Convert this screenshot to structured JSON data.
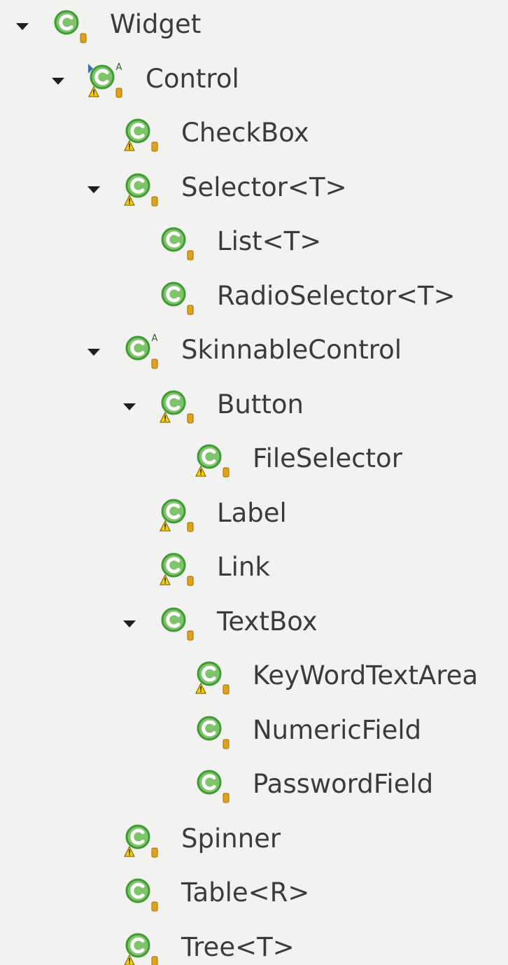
{
  "tree": {
    "nodes": [
      {
        "label": "Widget",
        "depth": 0,
        "expanded": true,
        "warning": false,
        "abstract": false,
        "tags": []
      },
      {
        "label": "Control",
        "depth": 1,
        "expanded": true,
        "warning": true,
        "abstract": true,
        "tags": [
          "abstract",
          "warning",
          "override"
        ]
      },
      {
        "label": "CheckBox",
        "depth": 2,
        "expanded": false,
        "warning": true,
        "abstract": false,
        "tags": [
          "warning"
        ]
      },
      {
        "label": "Selector<T>",
        "depth": 2,
        "expanded": true,
        "warning": true,
        "abstract": false,
        "tags": [
          "warning"
        ]
      },
      {
        "label": "List<T>",
        "depth": 3,
        "expanded": false,
        "warning": false,
        "abstract": false,
        "tags": []
      },
      {
        "label": "RadioSelector<T>",
        "depth": 3,
        "expanded": false,
        "warning": false,
        "abstract": false,
        "tags": []
      },
      {
        "label": "SkinnableControl",
        "depth": 2,
        "expanded": true,
        "warning": false,
        "abstract": true,
        "tags": [
          "abstract"
        ]
      },
      {
        "label": "Button",
        "depth": 3,
        "expanded": true,
        "warning": true,
        "abstract": false,
        "tags": [
          "warning"
        ]
      },
      {
        "label": "FileSelector",
        "depth": 4,
        "expanded": false,
        "warning": true,
        "abstract": false,
        "tags": [
          "warning"
        ]
      },
      {
        "label": "Label",
        "depth": 3,
        "expanded": false,
        "warning": true,
        "abstract": false,
        "tags": [
          "warning"
        ]
      },
      {
        "label": "Link",
        "depth": 3,
        "expanded": false,
        "warning": true,
        "abstract": false,
        "tags": [
          "warning"
        ]
      },
      {
        "label": "TextBox",
        "depth": 3,
        "expanded": true,
        "warning": false,
        "abstract": false,
        "tags": []
      },
      {
        "label": "KeyWordTextArea",
        "depth": 4,
        "expanded": false,
        "warning": true,
        "abstract": false,
        "tags": [
          "warning"
        ]
      },
      {
        "label": "NumericField",
        "depth": 4,
        "expanded": false,
        "warning": false,
        "abstract": false,
        "tags": []
      },
      {
        "label": "PasswordField",
        "depth": 4,
        "expanded": false,
        "warning": false,
        "abstract": false,
        "tags": []
      },
      {
        "label": "Spinner",
        "depth": 2,
        "expanded": false,
        "warning": true,
        "abstract": false,
        "tags": [
          "warning"
        ]
      },
      {
        "label": "Table<R>",
        "depth": 2,
        "expanded": false,
        "warning": false,
        "abstract": false,
        "tags": []
      },
      {
        "label": "Tree<T>",
        "depth": 2,
        "expanded": false,
        "warning": true,
        "abstract": false,
        "tags": [
          "warning"
        ]
      }
    ]
  },
  "icons": {
    "class_icon": "class-icon",
    "warning_overlay": "warning-icon",
    "visibility_badge": "default-visibility-icon",
    "abstract_badge": "abstract-icon",
    "expand_toggle": "chevron-down-icon"
  },
  "colors": {
    "background": "#f2f2f1",
    "class_green": "#3f9c35",
    "class_green_light": "#7fc36a",
    "visibility_orange": "#e0a21a",
    "warning_yellow": "#f5d000",
    "text": "#3b3b3b"
  }
}
